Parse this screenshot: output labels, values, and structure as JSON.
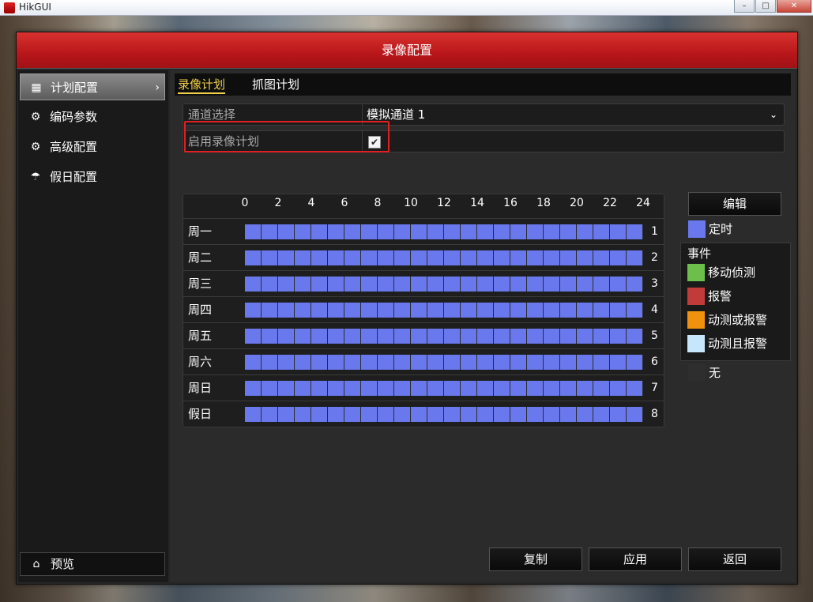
{
  "window": {
    "title": "HikGUI"
  },
  "dialog": {
    "title": "录像配置"
  },
  "sidebar": {
    "items": [
      {
        "label": "计划配置",
        "icon": "calendar-icon",
        "active": true
      },
      {
        "label": "编码参数",
        "icon": "gear-icon",
        "active": false
      },
      {
        "label": "高级配置",
        "icon": "gears-icon",
        "active": false
      },
      {
        "label": "假日配置",
        "icon": "umbrella-icon",
        "active": false
      }
    ],
    "preview_label": "预览"
  },
  "tabs": [
    {
      "label": "录像计划",
      "active": true
    },
    {
      "label": "抓图计划",
      "active": false
    }
  ],
  "channel": {
    "label": "通道选择",
    "value": "模拟通道 1"
  },
  "enable_schedule": {
    "label": "启用录像计划",
    "checked": true,
    "check_glyph": "✔"
  },
  "schedule": {
    "hours": [
      "0",
      "2",
      "4",
      "6",
      "8",
      "10",
      "12",
      "14",
      "16",
      "18",
      "20",
      "22",
      "24"
    ],
    "days": [
      {
        "label": "周一",
        "num": "1"
      },
      {
        "label": "周二",
        "num": "2"
      },
      {
        "label": "周三",
        "num": "3"
      },
      {
        "label": "周四",
        "num": "4"
      },
      {
        "label": "周五",
        "num": "5"
      },
      {
        "label": "周六",
        "num": "6"
      },
      {
        "label": "周日",
        "num": "7"
      },
      {
        "label": "假日",
        "num": "8"
      }
    ],
    "fill_color": "#6a78ee"
  },
  "edit_button": "编辑",
  "legend": {
    "timed": {
      "label": "定时",
      "color": "#6a78ee"
    },
    "event_title": "事件",
    "events": [
      {
        "label": "移动侦测",
        "color": "#6cbf4a"
      },
      {
        "label": "报警",
        "color": "#c23b3b"
      },
      {
        "label": "动测或报警",
        "color": "#f0920e"
      },
      {
        "label": "动测且报警",
        "color": "#c6e6fb"
      }
    ],
    "none": {
      "label": "无",
      "color": "#2e2e2e"
    }
  },
  "footer_buttons": {
    "copy": "复制",
    "apply": "应用",
    "back": "返回"
  }
}
